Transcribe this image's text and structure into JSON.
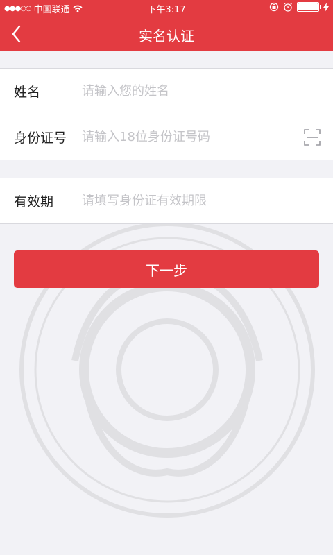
{
  "status_bar": {
    "signal": "●●●○○",
    "carrier": "中国联通",
    "time": "下午3:17",
    "battery_level": 1.0
  },
  "navbar": {
    "title": "实名认证",
    "back_icon": "chevron-left-icon"
  },
  "form": {
    "name": {
      "label": "姓名",
      "placeholder": "请输入您的姓名"
    },
    "id_number": {
      "label": "身份证号",
      "placeholder": "请输入18位身份证号码",
      "scan_icon": "scan-icon"
    },
    "validity": {
      "label": "有效期",
      "placeholder": "请填写身份证有效期限"
    }
  },
  "next_button": {
    "label": "下一步"
  },
  "colors": {
    "brand": "#e33b41",
    "background": "#f2f2f6",
    "placeholder": "#c4c4c8"
  }
}
